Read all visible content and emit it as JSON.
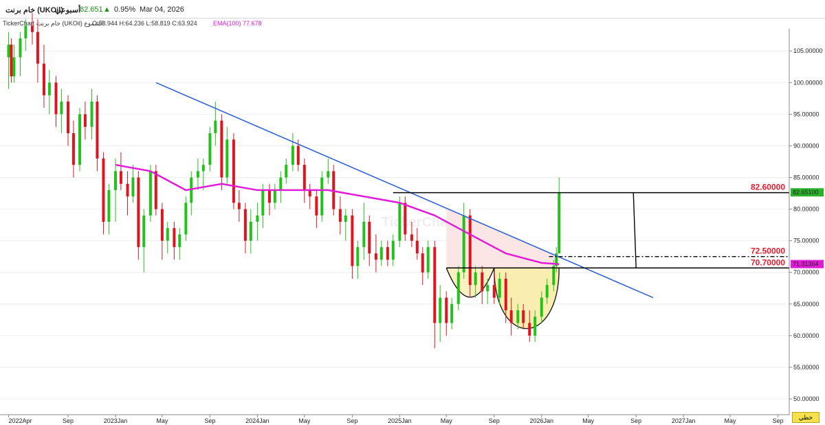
{
  "header": {
    "title": "خام برنت (UKOil)",
    "period": "أسبوعي",
    "last": "82.651",
    "change": "0.95%",
    "date": "Mar 04, 2026"
  },
  "infobar": {
    "source": "TickerChart خام برنت (UKOil) الشموع",
    "ohlc": "O:58.944 H:64.236 L:58.819 C:63.924",
    "ema": "EMA(100) 77.678"
  },
  "watermark": "TickerChart",
  "corner_label": "خطي",
  "colors": {
    "up": "#22c21a",
    "down": "#e0141f",
    "ema": "#e21bd8",
    "trend": "#2f63d6",
    "annotation": "#e8192c",
    "cup": "#f9eeab",
    "lastbadge": "#2ab32a",
    "emabadge": "#e21bd8"
  },
  "chart_data": {
    "type": "candlestick",
    "ylim": [
      47.5,
      108.5
    ],
    "yticks": [
      "50.00000",
      "55.00000",
      "60.00000",
      "65.00000",
      "70.00000",
      "75.00000",
      "80.00000",
      "85.00000",
      "90.00000",
      "95.00000",
      "100.00000",
      "105.00000"
    ],
    "xticks": [
      "2022Apr",
      "Sep",
      "2023Jan",
      "May",
      "Sep",
      "2024Jan",
      "May",
      "Sep",
      "2025Jan",
      "May",
      "Sep",
      "2026Jan",
      "May",
      "Sep",
      "2027Jan",
      "May",
      "Sep"
    ],
    "xtick_dates": [
      "2022-04-01",
      "2022-09-01",
      "2023-01-01",
      "2023-05-01",
      "2023-09-01",
      "2024-01-01",
      "2024-05-01",
      "2024-09-01",
      "2025-01-01",
      "2025-05-01",
      "2025-09-01",
      "2026-01-01",
      "2026-05-01",
      "2026-09-01",
      "2027-01-01",
      "2027-05-01",
      "2027-09-01"
    ],
    "candles": [
      {
        "d": "2022-04-01",
        "o": 104,
        "h": 108,
        "l": 99,
        "c": 106
      },
      {
        "d": "2022-04-08",
        "o": 106,
        "h": 107,
        "l": 100,
        "c": 101
      },
      {
        "d": "2022-04-15",
        "o": 101,
        "h": 106,
        "l": 100,
        "c": 104
      },
      {
        "d": "2022-05-01",
        "o": 104,
        "h": 108,
        "l": 101,
        "c": 107
      },
      {
        "d": "2022-05-15",
        "o": 107,
        "h": 110,
        "l": 105,
        "c": 109
      },
      {
        "d": "2022-06-01",
        "o": 109,
        "h": 111,
        "l": 106,
        "c": 108
      },
      {
        "d": "2022-06-15",
        "o": 108,
        "h": 110,
        "l": 100,
        "c": 103
      },
      {
        "d": "2022-07-01",
        "o": 103,
        "h": 106,
        "l": 96,
        "c": 98
      },
      {
        "d": "2022-07-15",
        "o": 98,
        "h": 102,
        "l": 95,
        "c": 100
      },
      {
        "d": "2022-08-01",
        "o": 100,
        "h": 101,
        "l": 93,
        "c": 95
      },
      {
        "d": "2022-08-15",
        "o": 95,
        "h": 99,
        "l": 92,
        "c": 97
      },
      {
        "d": "2022-09-01",
        "o": 97,
        "h": 98,
        "l": 90,
        "c": 92
      },
      {
        "d": "2022-09-15",
        "o": 92,
        "h": 94,
        "l": 85,
        "c": 87
      },
      {
        "d": "2022-10-01",
        "o": 87,
        "h": 96,
        "l": 86,
        "c": 95
      },
      {
        "d": "2022-10-15",
        "o": 95,
        "h": 97,
        "l": 91,
        "c": 93
      },
      {
        "d": "2022-11-01",
        "o": 93,
        "h": 99,
        "l": 91,
        "c": 97
      },
      {
        "d": "2022-11-15",
        "o": 97,
        "h": 98,
        "l": 86,
        "c": 88
      },
      {
        "d": "2022-12-01",
        "o": 88,
        "h": 89,
        "l": 76,
        "c": 78
      },
      {
        "d": "2022-12-15",
        "o": 78,
        "h": 84,
        "l": 76,
        "c": 83
      },
      {
        "d": "2023-01-01",
        "o": 83,
        "h": 88,
        "l": 78,
        "c": 86
      },
      {
        "d": "2023-01-15",
        "o": 86,
        "h": 89,
        "l": 83,
        "c": 84
      },
      {
        "d": "2023-02-01",
        "o": 84,
        "h": 86,
        "l": 79,
        "c": 82
      },
      {
        "d": "2023-02-15",
        "o": 82,
        "h": 87,
        "l": 81,
        "c": 85
      },
      {
        "d": "2023-03-01",
        "o": 85,
        "h": 86,
        "l": 72,
        "c": 74
      },
      {
        "d": "2023-03-15",
        "o": 74,
        "h": 80,
        "l": 70,
        "c": 79
      },
      {
        "d": "2023-04-01",
        "o": 79,
        "h": 87,
        "l": 78,
        "c": 86
      },
      {
        "d": "2023-04-15",
        "o": 86,
        "h": 87,
        "l": 79,
        "c": 80
      },
      {
        "d": "2023-05-01",
        "o": 80,
        "h": 81,
        "l": 72,
        "c": 75
      },
      {
        "d": "2023-05-15",
        "o": 75,
        "h": 78,
        "l": 73,
        "c": 77
      },
      {
        "d": "2023-06-01",
        "o": 77,
        "h": 78,
        "l": 72,
        "c": 74
      },
      {
        "d": "2023-06-15",
        "o": 74,
        "h": 77,
        "l": 72,
        "c": 76
      },
      {
        "d": "2023-07-01",
        "o": 76,
        "h": 82,
        "l": 75,
        "c": 81
      },
      {
        "d": "2023-07-15",
        "o": 81,
        "h": 86,
        "l": 79,
        "c": 85
      },
      {
        "d": "2023-08-01",
        "o": 85,
        "h": 88,
        "l": 83,
        "c": 86
      },
      {
        "d": "2023-08-15",
        "o": 86,
        "h": 88,
        "l": 83,
        "c": 87
      },
      {
        "d": "2023-09-01",
        "o": 87,
        "h": 93,
        "l": 86,
        "c": 92
      },
      {
        "d": "2023-09-15",
        "o": 92,
        "h": 97,
        "l": 90,
        "c": 94
      },
      {
        "d": "2023-10-01",
        "o": 94,
        "h": 95,
        "l": 83,
        "c": 85
      },
      {
        "d": "2023-10-15",
        "o": 85,
        "h": 93,
        "l": 84,
        "c": 91
      },
      {
        "d": "2023-11-01",
        "o": 91,
        "h": 92,
        "l": 80,
        "c": 81
      },
      {
        "d": "2023-11-15",
        "o": 81,
        "h": 83,
        "l": 78,
        "c": 80
      },
      {
        "d": "2023-12-01",
        "o": 80,
        "h": 81,
        "l": 73,
        "c": 75
      },
      {
        "d": "2023-12-15",
        "o": 75,
        "h": 80,
        "l": 73,
        "c": 78
      },
      {
        "d": "2024-01-01",
        "o": 78,
        "h": 81,
        "l": 75,
        "c": 79
      },
      {
        "d": "2024-01-15",
        "o": 79,
        "h": 84,
        "l": 77,
        "c": 83
      },
      {
        "d": "2024-02-01",
        "o": 83,
        "h": 84,
        "l": 79,
        "c": 81
      },
      {
        "d": "2024-02-15",
        "o": 81,
        "h": 84,
        "l": 80,
        "c": 83
      },
      {
        "d": "2024-03-01",
        "o": 83,
        "h": 86,
        "l": 81,
        "c": 85
      },
      {
        "d": "2024-03-15",
        "o": 85,
        "h": 88,
        "l": 84,
        "c": 87
      },
      {
        "d": "2024-04-01",
        "o": 87,
        "h": 92,
        "l": 86,
        "c": 90
      },
      {
        "d": "2024-04-15",
        "o": 90,
        "h": 91,
        "l": 86,
        "c": 87
      },
      {
        "d": "2024-05-01",
        "o": 87,
        "h": 88,
        "l": 81,
        "c": 83
      },
      {
        "d": "2024-05-15",
        "o": 83,
        "h": 84,
        "l": 80,
        "c": 82
      },
      {
        "d": "2024-06-01",
        "o": 82,
        "h": 83,
        "l": 77,
        "c": 79
      },
      {
        "d": "2024-06-15",
        "o": 79,
        "h": 86,
        "l": 78,
        "c": 85
      },
      {
        "d": "2024-07-01",
        "o": 85,
        "h": 88,
        "l": 84,
        "c": 86
      },
      {
        "d": "2024-07-15",
        "o": 86,
        "h": 87,
        "l": 79,
        "c": 80
      },
      {
        "d": "2024-08-01",
        "o": 80,
        "h": 82,
        "l": 76,
        "c": 78
      },
      {
        "d": "2024-08-15",
        "o": 78,
        "h": 80,
        "l": 75,
        "c": 79
      },
      {
        "d": "2024-09-01",
        "o": 79,
        "h": 80,
        "l": 69,
        "c": 71
      },
      {
        "d": "2024-09-15",
        "o": 71,
        "h": 75,
        "l": 69,
        "c": 74
      },
      {
        "d": "2024-10-01",
        "o": 74,
        "h": 81,
        "l": 72,
        "c": 78
      },
      {
        "d": "2024-10-15",
        "o": 78,
        "h": 79,
        "l": 71,
        "c": 73
      },
      {
        "d": "2024-11-01",
        "o": 73,
        "h": 76,
        "l": 70,
        "c": 72
      },
      {
        "d": "2024-11-15",
        "o": 72,
        "h": 75,
        "l": 71,
        "c": 74
      },
      {
        "d": "2024-12-01",
        "o": 74,
        "h": 75,
        "l": 71,
        "c": 72
      },
      {
        "d": "2024-12-15",
        "o": 72,
        "h": 76,
        "l": 71,
        "c": 75
      },
      {
        "d": "2025-01-01",
        "o": 75,
        "h": 82,
        "l": 74,
        "c": 81
      },
      {
        "d": "2025-01-15",
        "o": 81,
        "h": 82,
        "l": 75,
        "c": 76
      },
      {
        "d": "2025-02-01",
        "o": 76,
        "h": 78,
        "l": 74,
        "c": 75
      },
      {
        "d": "2025-02-15",
        "o": 75,
        "h": 77,
        "l": 72,
        "c": 73
      },
      {
        "d": "2025-03-01",
        "o": 73,
        "h": 74,
        "l": 68,
        "c": 70
      },
      {
        "d": "2025-03-15",
        "o": 70,
        "h": 75,
        "l": 69,
        "c": 74
      },
      {
        "d": "2025-04-01",
        "o": 74,
        "h": 75,
        "l": 58,
        "c": 62
      },
      {
        "d": "2025-04-15",
        "o": 62,
        "h": 68,
        "l": 59,
        "c": 66
      },
      {
        "d": "2025-05-01",
        "o": 66,
        "h": 67,
        "l": 60,
        "c": 62
      },
      {
        "d": "2025-05-15",
        "o": 62,
        "h": 66,
        "l": 61,
        "c": 65
      },
      {
        "d": "2025-06-01",
        "o": 65,
        "h": 71,
        "l": 64,
        "c": 70
      },
      {
        "d": "2025-06-15",
        "o": 70,
        "h": 81,
        "l": 69,
        "c": 79
      },
      {
        "d": "2025-07-01",
        "o": 79,
        "h": 80,
        "l": 66,
        "c": 68
      },
      {
        "d": "2025-07-15",
        "o": 68,
        "h": 71,
        "l": 66,
        "c": 70
      },
      {
        "d": "2025-08-01",
        "o": 70,
        "h": 71,
        "l": 65,
        "c": 67
      },
      {
        "d": "2025-08-15",
        "o": 67,
        "h": 69,
        "l": 65,
        "c": 68
      },
      {
        "d": "2025-09-01",
        "o": 68,
        "h": 70,
        "l": 65,
        "c": 66
      },
      {
        "d": "2025-09-15",
        "o": 66,
        "h": 70,
        "l": 65,
        "c": 69
      },
      {
        "d": "2025-10-01",
        "o": 69,
        "h": 70,
        "l": 62,
        "c": 64
      },
      {
        "d": "2025-10-15",
        "o": 64,
        "h": 66,
        "l": 60,
        "c": 62
      },
      {
        "d": "2025-11-01",
        "o": 62,
        "h": 65,
        "l": 61,
        "c": 64
      },
      {
        "d": "2025-11-15",
        "o": 64,
        "h": 65,
        "l": 61,
        "c": 62
      },
      {
        "d": "2025-12-01",
        "o": 62,
        "h": 64,
        "l": 59,
        "c": 60
      },
      {
        "d": "2025-12-15",
        "o": 60,
        "h": 64,
        "l": 59,
        "c": 63
      },
      {
        "d": "2026-01-01",
        "o": 63,
        "h": 67,
        "l": 62,
        "c": 66
      },
      {
        "d": "2026-01-15",
        "o": 66,
        "h": 69,
        "l": 65,
        "c": 68
      },
      {
        "d": "2026-02-01",
        "o": 68,
        "h": 72,
        "l": 67,
        "c": 71
      },
      {
        "d": "2026-02-08",
        "o": 71,
        "h": 74,
        "l": 70,
        "c": 73
      },
      {
        "d": "2026-02-15",
        "o": 73,
        "h": 85,
        "l": 76,
        "c": 82.65
      }
    ],
    "ema": [
      {
        "d": "2023-01-01",
        "v": 87
      },
      {
        "d": "2023-04-01",
        "v": 86
      },
      {
        "d": "2023-07-01",
        "v": 83
      },
      {
        "d": "2023-10-01",
        "v": 84
      },
      {
        "d": "2024-01-01",
        "v": 83
      },
      {
        "d": "2024-04-01",
        "v": 83
      },
      {
        "d": "2024-07-01",
        "v": 83
      },
      {
        "d": "2024-10-01",
        "v": 82
      },
      {
        "d": "2025-01-01",
        "v": 81
      },
      {
        "d": "2025-04-01",
        "v": 79
      },
      {
        "d": "2025-07-01",
        "v": 76
      },
      {
        "d": "2025-10-01",
        "v": 73
      },
      {
        "d": "2026-01-01",
        "v": 71.5
      },
      {
        "d": "2026-02-15",
        "v": 71.3
      }
    ],
    "trendline": {
      "from": {
        "d": "2023-04-15",
        "v": 100
      },
      "to": {
        "d": "2026-10-15",
        "v": 66
      }
    },
    "levels": [
      {
        "label": "82.60000",
        "v": 82.6,
        "from": "2024-12-15",
        "to": "2027-09-30",
        "style": "solid"
      },
      {
        "label": "72.50000",
        "v": 72.5,
        "from": "2026-01-20",
        "to": "2027-09-30",
        "style": "dashdot"
      },
      {
        "label": "70.70000",
        "v": 70.7,
        "from": "2025-05-01",
        "to": "2027-09-30",
        "style": "solid"
      }
    ],
    "measure": {
      "d": "2026-08-25",
      "from": 82.6,
      "to": 70.7
    },
    "pattern": {
      "triangle_base_from": "2025-05-01",
      "triangle_base_to": "2026-02-15",
      "shoulder_bottom": 64.5,
      "cup_bottom": 59
    },
    "badges": [
      {
        "label": "82.65100",
        "v": 82.651,
        "kind": "last"
      },
      {
        "label": "71.31364",
        "v": 71.31364,
        "kind": "ema"
      }
    ]
  }
}
